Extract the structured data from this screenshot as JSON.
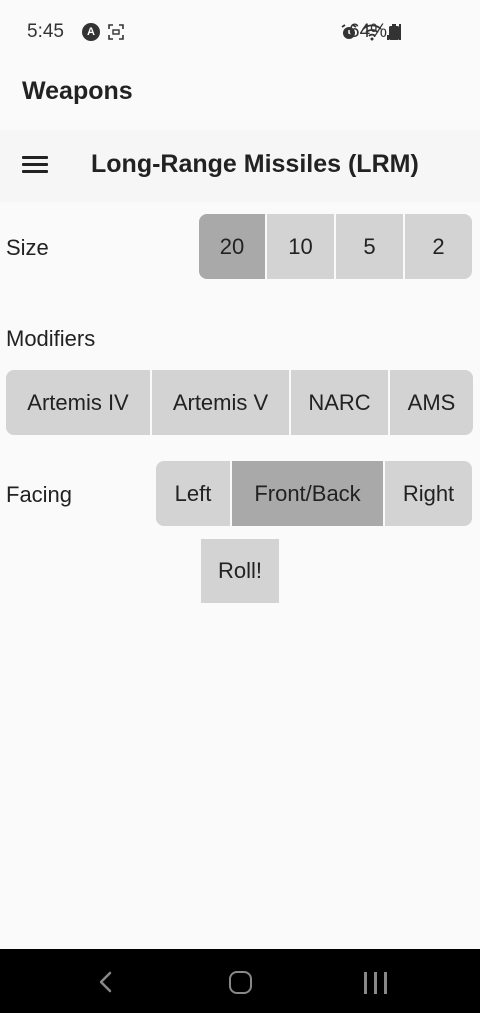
{
  "status_bar": {
    "time": "5:45",
    "battery": "64%"
  },
  "app": {
    "title": "Weapons"
  },
  "toolbar": {
    "weapon_title": "Long-Range Missiles (LRM)",
    "menu_icon": "hamburger-menu-icon"
  },
  "size": {
    "label": "Size",
    "options": [
      "20",
      "10",
      "5",
      "2"
    ],
    "selected": "20"
  },
  "modifiers": {
    "label": "Modifiers",
    "options": [
      "Artemis IV",
      "Artemis V",
      "NARC",
      "AMS"
    ]
  },
  "facing": {
    "label": "Facing",
    "options": [
      "Left",
      "Front/Back",
      "Right"
    ],
    "selected": "Front/Back"
  },
  "roll": {
    "label": "Roll!"
  },
  "colors": {
    "button": "#d3d3d3",
    "button_selected": "#a9a9a9",
    "background": "#fafafa",
    "nav_bar": "#000000"
  }
}
